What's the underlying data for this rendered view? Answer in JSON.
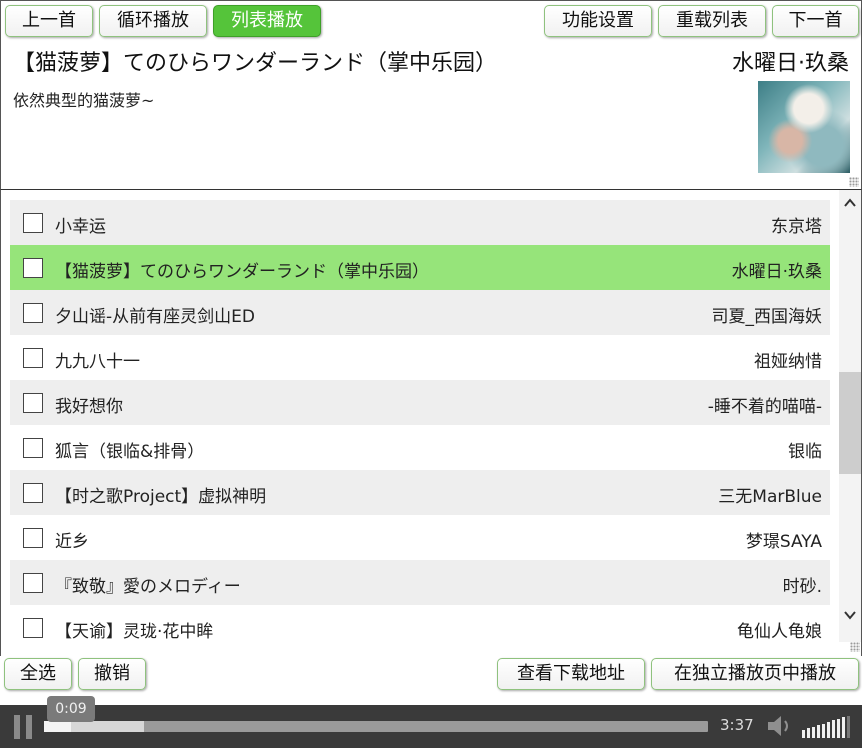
{
  "toolbar": {
    "prev_label": "上一首",
    "loop_label": "循环播放",
    "list_label": "列表播放",
    "settings_label": "功能设置",
    "reload_label": "重载列表",
    "next_label": "下一首"
  },
  "now_playing": {
    "title": "【猫菠萝】てのひらワンダーランド（掌中乐园）",
    "artist": "水曜日·玖桑",
    "description": "依然典型的猫菠萝~"
  },
  "playlist": [
    {
      "title": "小幸运",
      "artist": "东京塔",
      "checked": false,
      "playing": false
    },
    {
      "title": "【猫菠萝】てのひらワンダーランド（掌中乐园）",
      "artist": "水曜日·玖桑",
      "checked": false,
      "playing": true
    },
    {
      "title": "夕山谣-从前有座灵剑山ED",
      "artist": "司夏_西国海妖",
      "checked": false,
      "playing": false
    },
    {
      "title": "九九八十一",
      "artist": "祖娅纳惜",
      "checked": false,
      "playing": false
    },
    {
      "title": "我好想你",
      "artist": "-睡不着的喵喵-",
      "checked": false,
      "playing": false
    },
    {
      "title": "狐言（银临&排骨）",
      "artist": "银临",
      "checked": false,
      "playing": false
    },
    {
      "title": "【时之歌Project】虚拟神明",
      "artist": "三无MarBlue",
      "checked": false,
      "playing": false
    },
    {
      "title": "近乡",
      "artist": "梦璟SAYA",
      "checked": false,
      "playing": false
    },
    {
      "title": "『致敬』愛のメロディー",
      "artist": "时砂.",
      "checked": false,
      "playing": false
    },
    {
      "title": "【天谕】灵珑·花中眸",
      "artist": "龟仙人龟娘",
      "checked": false,
      "playing": false
    }
  ],
  "bottom_bar": {
    "select_all_label": "全选",
    "undo_label": "撤销",
    "download_label": "查看下载地址",
    "standalone_label": "在独立播放页中播放"
  },
  "player": {
    "current_time": "0:09",
    "duration": "3:37",
    "played_fraction": 0.04,
    "buffered_fraction": 0.15,
    "volume_level": 0.9
  },
  "colors": {
    "accent_green": "#55c43a",
    "playing_row": "#96e47a",
    "player_bar": "#3a3a3a"
  },
  "icons": {
    "pause": "pause-icon",
    "volume": "volume-icon",
    "scroll_up": "chevron-up-icon",
    "scroll_down": "chevron-down-icon"
  }
}
